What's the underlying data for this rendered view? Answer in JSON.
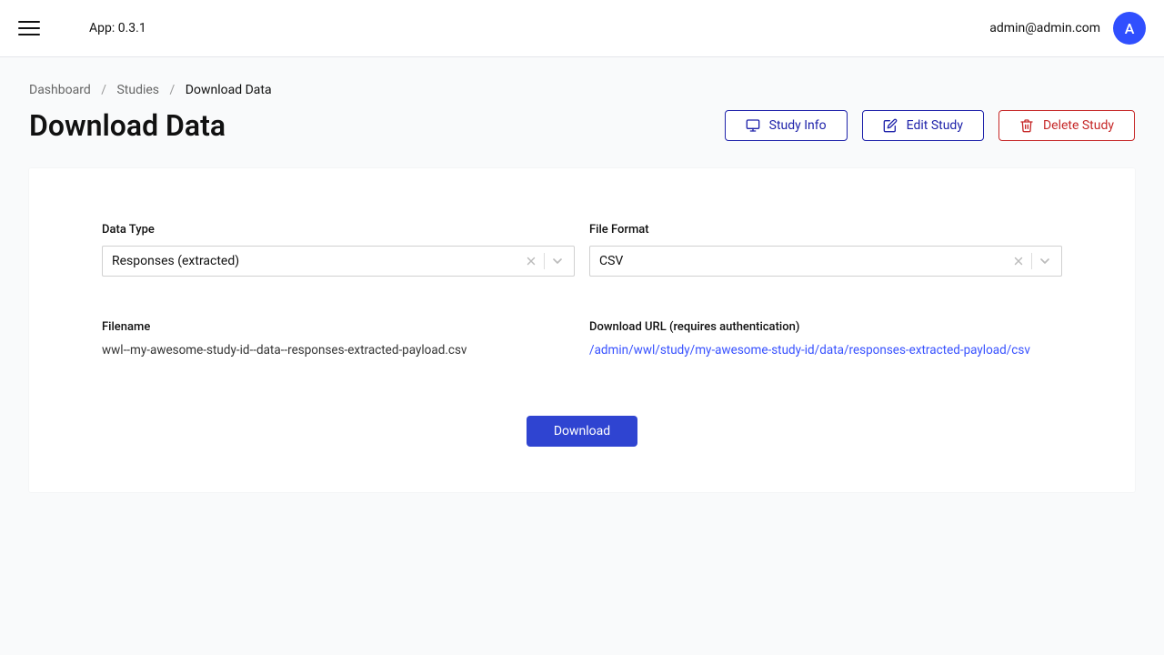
{
  "header": {
    "app_version": "App: 0.3.1",
    "user_email": "admin@admin.com",
    "avatar_letter": "A"
  },
  "breadcrumb": {
    "items": [
      "Dashboard",
      "Studies",
      "Download Data"
    ]
  },
  "page": {
    "title": "Download Data"
  },
  "actions": {
    "study_info": "Study Info",
    "edit_study": "Edit Study",
    "delete_study": "Delete Study"
  },
  "form": {
    "data_type": {
      "label": "Data Type",
      "value": "Responses (extracted)"
    },
    "file_format": {
      "label": "File Format",
      "value": "CSV"
    },
    "filename": {
      "label": "Filename",
      "value": "wwl--my-awesome-study-id--data--responses-extracted-payload.csv"
    },
    "download_url": {
      "label": "Download URL (requires authentication)",
      "value": "/admin/wwl/study/my-awesome-study-id/data/responses-extracted-payload/csv"
    },
    "download_button": "Download"
  }
}
